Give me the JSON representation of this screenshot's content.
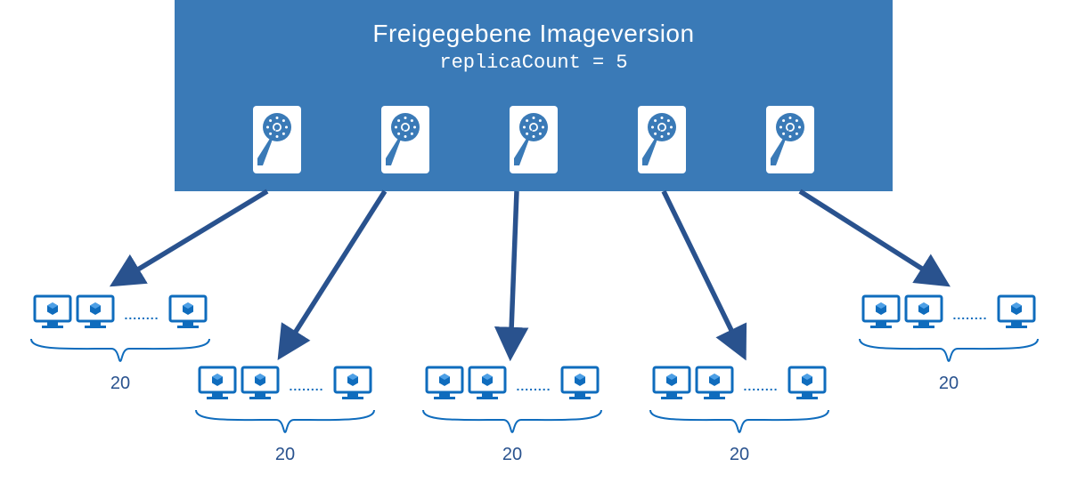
{
  "header": {
    "title": "Freigegebene Imageversion",
    "subtitle": "replicaCount = 5",
    "box_color": "#3a7ab7"
  },
  "replica_count": 5,
  "vm_groups": [
    {
      "label": "20",
      "dots": "........"
    },
    {
      "label": "20",
      "dots": "........"
    },
    {
      "label": "20",
      "dots": "........"
    },
    {
      "label": "20",
      "dots": "........"
    },
    {
      "label": "20",
      "dots": "........"
    }
  ],
  "colors": {
    "arrow": "#29528e",
    "vm_outline": "#0f6cbd",
    "brace": "#0f6cbd",
    "disk_fill": "#ffffff"
  }
}
